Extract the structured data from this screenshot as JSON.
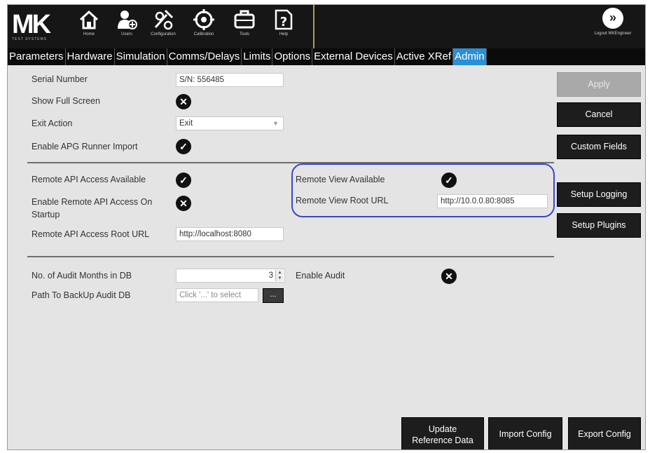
{
  "brand": {
    "logo_main": "MK",
    "logo_sub": "TEST SYSTEMS"
  },
  "toolbar": [
    {
      "icon": "home-icon",
      "label": "Home"
    },
    {
      "icon": "users-icon",
      "label": "Users"
    },
    {
      "icon": "configuration-icon",
      "label": "Configuration"
    },
    {
      "icon": "calibration-icon",
      "label": "Calibration"
    },
    {
      "icon": "tools-icon",
      "label": "Tools"
    },
    {
      "icon": "help-icon",
      "label": "Help"
    }
  ],
  "logout": {
    "label": "Logout MKEngineer"
  },
  "tabs": [
    "Parameters",
    "Hardware",
    "Simulation",
    "Comms/Delays",
    "Limits",
    "Options",
    "External Devices",
    "Active XRef",
    "Admin"
  ],
  "active_tab": "Admin",
  "section1": {
    "serial_label": "Serial Number",
    "serial_value": "S/N: 556485",
    "fullscreen_label": "Show Full Screen",
    "fullscreen_state": "off",
    "exit_label": "Exit Action",
    "exit_value": "Exit",
    "apg_label": "Enable APG Runner Import",
    "apg_state": "on"
  },
  "section2": {
    "api_avail_label": "Remote API Access Available",
    "api_avail_state": "on",
    "api_startup_label": "Enable Remote API Access On Startup",
    "api_startup_state": "off",
    "api_url_label": "Remote API Access Root URL",
    "api_url_value": "http://localhost:8080",
    "view_avail_label": "Remote View Available",
    "view_avail_state": "on",
    "view_url_label": "Remote View Root URL",
    "view_url_value": "http://10.0.0.80:8085"
  },
  "section3": {
    "audit_months_label": "No. of Audit Months in DB",
    "audit_months_value": "3",
    "audit_path_label": "Path To BackUp Audit DB",
    "audit_path_placeholder": "Click '...' to select",
    "browse_label": "...",
    "enable_audit_label": "Enable Audit",
    "enable_audit_state": "off"
  },
  "buttons": {
    "apply": "Apply",
    "cancel": "Cancel",
    "custom_fields": "Custom Fields",
    "setup_logging": "Setup Logging",
    "setup_plugins": "Setup Plugins",
    "update_ref_line1": "Update",
    "update_ref_line2": "Reference Data",
    "import_config": "Import Config",
    "export_config": "Export Config"
  },
  "colors": {
    "active_tab": "#2a8fd6",
    "highlight_outline": "#3a47c9",
    "logo_accent": "#d91f26"
  }
}
